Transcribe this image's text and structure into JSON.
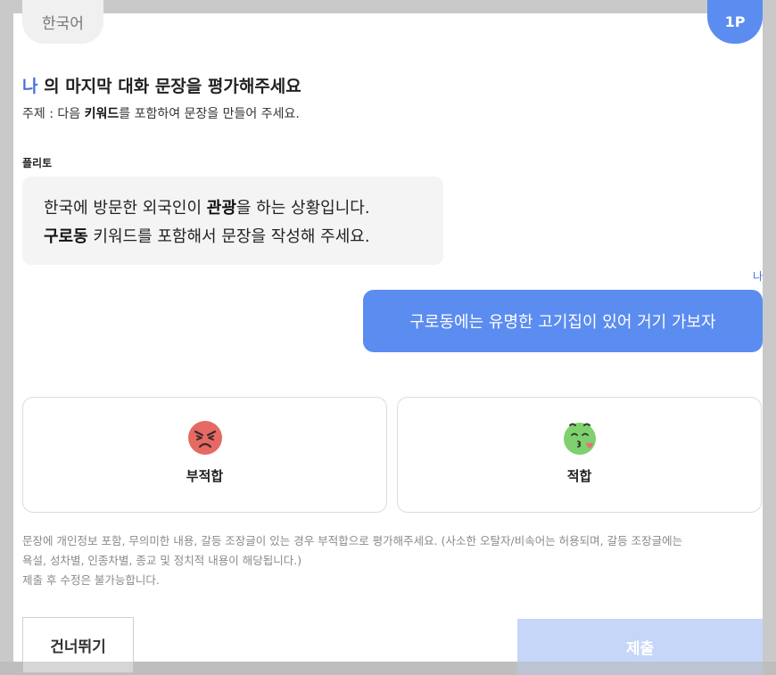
{
  "header": {
    "language": "한국어",
    "page_badge": "1P"
  },
  "title": {
    "speaker": "나",
    "text": " 의 마지막 대화 문장을 평가해주세요"
  },
  "subject": {
    "prefix": "주제 : 다음 ",
    "keyword": "키워드",
    "suffix": "를 포함하여 문장을 만들어 주세요."
  },
  "bot": {
    "name": "플리토",
    "line1_a": "한국에 방문한 외국인이 ",
    "line1_b": "관광",
    "line1_c": "을 하는 상황입니다.",
    "line2_a": "구로동",
    "line2_b": " 키워드를 포함해서 문장을 작성해 주세요."
  },
  "user": {
    "label": "나",
    "message": "구로동에는 유명한 고기집이 있어 거기 가보자"
  },
  "choices": {
    "bad_label": "부적합",
    "bad_icon": "angry-face-icon",
    "good_label": "적합",
    "good_icon": "kissing-face-icon"
  },
  "notice": {
    "line1": "문장에 개인정보 포함, 무의미한 내용, 갈등 조장글이 있는 경우 부적합으로 평가해주세요. (사소한 오탈자/비속어는 허용되며, 갈등 조장글에는",
    "line2": "욕설, 성차별, 인종차별, 종교 및 정치적 내용이 해당됩니다.)",
    "line3": "제출 후 수정은 불가능합니다."
  },
  "buttons": {
    "skip": "건너뛰기",
    "submit": "제출"
  },
  "colors": {
    "accent": "#5b8cf0",
    "submit_disabled": "#c6d6f8",
    "bad_face": "#e56a63",
    "good_face": "#7fd06e"
  }
}
